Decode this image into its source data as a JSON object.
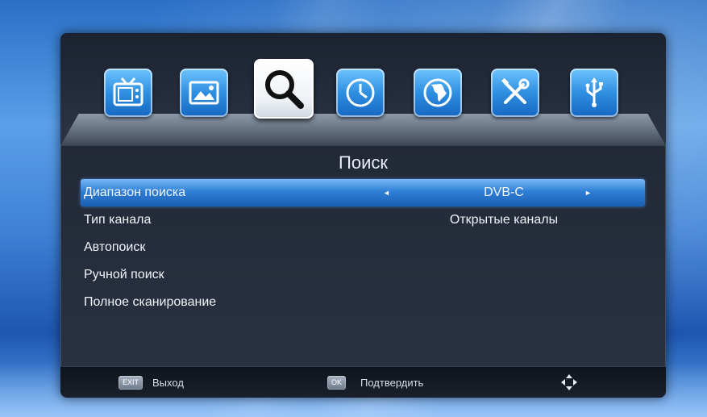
{
  "menu": {
    "icons": [
      {
        "name": "tv-icon"
      },
      {
        "name": "picture-icon"
      },
      {
        "name": "search-icon",
        "active": true
      },
      {
        "name": "clock-icon"
      },
      {
        "name": "globe-icon"
      },
      {
        "name": "tools-icon"
      },
      {
        "name": "usb-icon"
      }
    ]
  },
  "page": {
    "title": "Поиск"
  },
  "items": [
    {
      "label": "Диапазон поиска",
      "value": "DVB-C",
      "selected": true
    },
    {
      "label": "Тип канала",
      "value": "Открытые каналы"
    },
    {
      "label": "Автопоиск",
      "value": ""
    },
    {
      "label": "Ручной поиск",
      "value": ""
    },
    {
      "label": "Полное сканирование",
      "value": ""
    }
  ],
  "footer": {
    "exit_key": "EXIT",
    "exit_label": "Выход",
    "ok_key": "OK",
    "ok_label": "Подтвердить",
    "nav_icon": "navigation-arrows-icon"
  },
  "colors": {
    "accent": "#2f7fd6",
    "tile_blue": "#2e8fe0"
  }
}
